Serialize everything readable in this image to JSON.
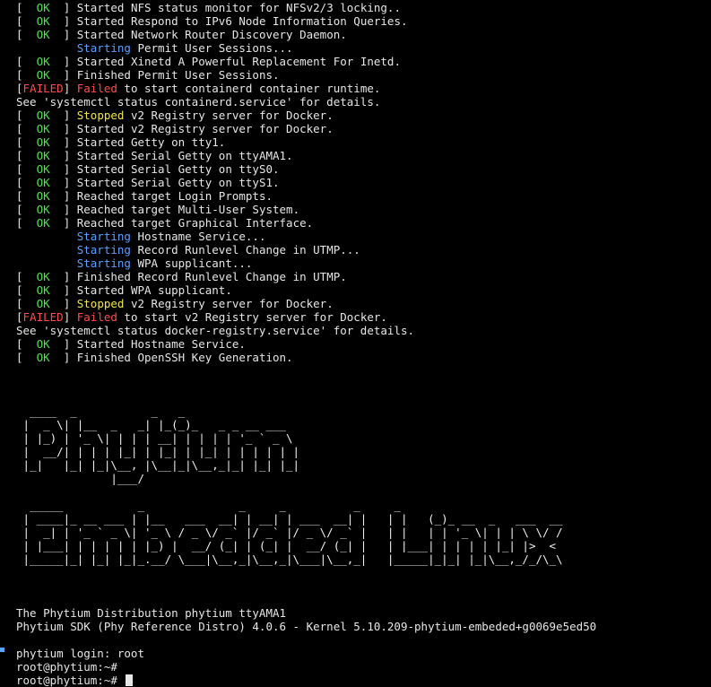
{
  "boot": [
    {
      "status": "OK",
      "verb": "",
      "verbStyle": "",
      "text": "Started NFS status monitor for NFSv2/3 locking.."
    },
    {
      "status": "OK",
      "verb": "",
      "verbStyle": "",
      "text": "Started Respond to IPv6 Node Information Queries."
    },
    {
      "status": "OK",
      "verb": "",
      "verbStyle": "",
      "text": "Started Network Router Discovery Daemon."
    },
    {
      "status": "",
      "verb": "Starting",
      "verbStyle": "starting",
      "text": " Permit User Sessions..."
    },
    {
      "status": "OK",
      "verb": "",
      "verbStyle": "",
      "text": "Started Xinetd A Powerful Replacement For Inetd."
    },
    {
      "status": "OK",
      "verb": "",
      "verbStyle": "",
      "text": "Finished Permit User Sessions."
    },
    {
      "status": "FAILED",
      "verb": "Failed",
      "verbStyle": "failed",
      "text": " to start containerd container runtime."
    },
    {
      "status": "NONE",
      "verb": "",
      "verbStyle": "",
      "text": "See 'systemctl status containerd.service' for details."
    },
    {
      "status": "OK",
      "verb": "Stopped",
      "verbStyle": "stopped",
      "text": " v2 Registry server for Docker."
    },
    {
      "status": "OK",
      "verb": "",
      "verbStyle": "",
      "text": "Started v2 Registry server for Docker."
    },
    {
      "status": "OK",
      "verb": "",
      "verbStyle": "",
      "text": "Started Getty on tty1."
    },
    {
      "status": "OK",
      "verb": "",
      "verbStyle": "",
      "text": "Started Serial Getty on ttyAMA1."
    },
    {
      "status": "OK",
      "verb": "",
      "verbStyle": "",
      "text": "Started Serial Getty on ttyS0."
    },
    {
      "status": "OK",
      "verb": "",
      "verbStyle": "",
      "text": "Started Serial Getty on ttyS1."
    },
    {
      "status": "OK",
      "verb": "",
      "verbStyle": "",
      "text": "Reached target Login Prompts."
    },
    {
      "status": "OK",
      "verb": "",
      "verbStyle": "",
      "text": "Reached target Multi-User System."
    },
    {
      "status": "OK",
      "verb": "",
      "verbStyle": "",
      "text": "Reached target Graphical Interface."
    },
    {
      "status": "",
      "verb": "Starting",
      "verbStyle": "starting",
      "text": " Hostname Service..."
    },
    {
      "status": "",
      "verb": "Starting",
      "verbStyle": "starting",
      "text": " Record Runlevel Change in UTMP..."
    },
    {
      "status": "",
      "verb": "Starting",
      "verbStyle": "starting",
      "text": " WPA supplicant..."
    },
    {
      "status": "OK",
      "verb": "",
      "verbStyle": "",
      "text": "Finished Record Runlevel Change in UTMP."
    },
    {
      "status": "OK",
      "verb": "",
      "verbStyle": "",
      "text": "Started WPA supplicant."
    },
    {
      "status": "OK",
      "verb": "Stopped",
      "verbStyle": "stopped",
      "text": " v2 Registry server for Docker."
    },
    {
      "status": "FAILED",
      "verb": "Failed",
      "verbStyle": "failed",
      "text": " to start v2 Registry server for Docker."
    },
    {
      "status": "NONE",
      "verb": "",
      "verbStyle": "",
      "text": "See 'systemctl status docker-registry.service' for details."
    },
    {
      "status": "OK",
      "verb": "",
      "verbStyle": "",
      "text": "Started Hostname Service."
    },
    {
      "status": "OK",
      "verb": "",
      "verbStyle": "",
      "text": "Finished OpenSSH Key Generation."
    }
  ],
  "ascii_art": [
    "  ____  _           _   _",
    " |  _ \\| |__  _   _| |_(_)_   _ _ __ ___",
    " | |_) | '_ \\| | | | __| | | | | '_ ` _ \\",
    " |  __/| | | | |_| | |_| | |_| | | | | | |",
    " |_|   |_| |_|\\__, |\\__|_|\\__,_|_| |_| |_|",
    "              |___/",
    "",
    "  _____           _              _     _          _     _",
    " | ____|_ __ ___ | |__   ___  __| | __| | ___  __| |   | |   (_)_ __  _   ___  __",
    " |  _| | '_ ` _ \\| '_ \\ / _ \\/ _` |/ _` |/ _ \\/ _` |   | |   | | '_ \\| | | \\ \\/ /",
    " | |___| | | | | | |_) |  __/ (_| | (_| |  __/ (_| |   | |___| | | | | |_| |>  <",
    " |_____|_| |_| |_|_.__/ \\___|\\__,_|\\__,_|\\___|\\__,_|   |_____|_|_| |_|\\__,_/_/\\_\\"
  ],
  "footer": {
    "distribution": "The Phytium Distribution phytium ttyAMA1",
    "sdk": "Phytium SDK (Phy Reference Distro) 4.0.6 - Kernel 5.10.209-phytium-embeded+g0069e5ed50",
    "login": "phytium login: root",
    "prompt1": "root@phytium:~#",
    "prompt2": "root@phytium:~#"
  },
  "colors": {
    "ok": "#4fe34f",
    "failed": "#ff4d4d",
    "starting": "#5aa0ff",
    "stopped": "#f0e64a",
    "text": "#e6e6e6",
    "background": "#000000"
  }
}
